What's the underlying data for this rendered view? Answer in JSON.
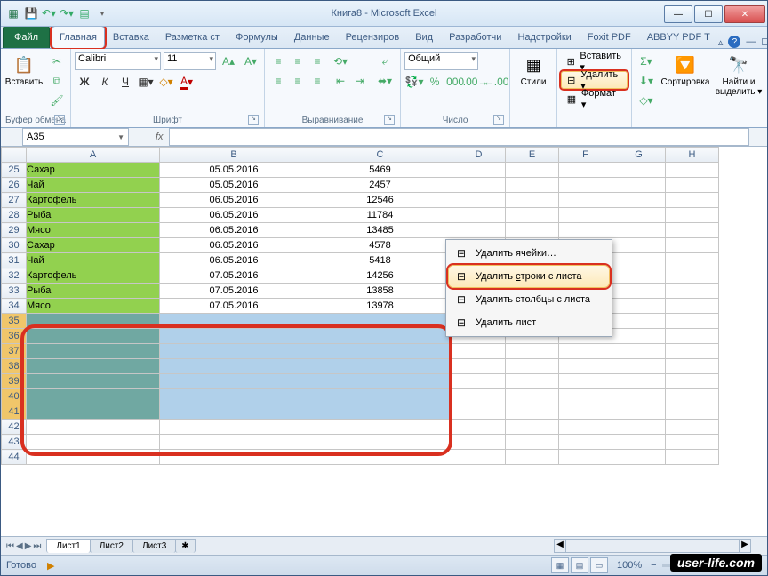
{
  "title": "Книга8 - Microsoft Excel",
  "tabs": {
    "file": "Файл",
    "home": "Главная",
    "t2": "Вставка",
    "t3": "Разметка ст",
    "t4": "Формулы",
    "t5": "Данные",
    "t6": "Рецензиров",
    "t7": "Вид",
    "t8": "Разработчи",
    "t9": "Надстройки",
    "t10": "Foxit PDF",
    "t11": "ABBYY PDF T"
  },
  "ribbon": {
    "clipboard": {
      "paste": "Вставить",
      "label": "Буфер обмена"
    },
    "font": {
      "name": "Calibri",
      "size": "11",
      "label": "Шрифт"
    },
    "align": {
      "label": "Выравнивание"
    },
    "number": {
      "format": "Общий",
      "label": "Число"
    },
    "styles": {
      "label": "Стили"
    },
    "cells": {
      "insert": "Вставить ▾",
      "delete": "Удалить ▾",
      "format": "Формат ▾"
    },
    "editing": {
      "sort": "Сортировка",
      "find": "Найти и выделить ▾"
    }
  },
  "menu": {
    "i1": "Удалить ячейки…",
    "i2": "Удалить строки с листа",
    "i3": "Удалить столбцы с листа",
    "i4": "Удалить лист"
  },
  "namebox": "A35",
  "fx": "fx",
  "cols": [
    "A",
    "B",
    "C",
    "D",
    "E",
    "F",
    "G",
    "H"
  ],
  "rows": [
    {
      "n": 25,
      "a": "Сахар",
      "b": "05.05.2016",
      "c": "5469"
    },
    {
      "n": 26,
      "a": "Чай",
      "b": "05.05.2016",
      "c": "2457"
    },
    {
      "n": 27,
      "a": "Картофель",
      "b": "06.05.2016",
      "c": "12546"
    },
    {
      "n": 28,
      "a": "Рыба",
      "b": "06.05.2016",
      "c": "11784"
    },
    {
      "n": 29,
      "a": "Мясо",
      "b": "06.05.2016",
      "c": "13485"
    },
    {
      "n": 30,
      "a": "Сахар",
      "b": "06.05.2016",
      "c": "4578"
    },
    {
      "n": 31,
      "a": "Чай",
      "b": "06.05.2016",
      "c": "5418"
    },
    {
      "n": 32,
      "a": "Картофель",
      "b": "07.05.2016",
      "c": "14256"
    },
    {
      "n": 33,
      "a": "Рыба",
      "b": "07.05.2016",
      "c": "13858"
    },
    {
      "n": 34,
      "a": "Мясо",
      "b": "07.05.2016",
      "c": "13978"
    }
  ],
  "selrows": [
    35,
    36,
    37,
    38,
    39,
    40,
    41
  ],
  "emptyrows": [
    42,
    43,
    44
  ],
  "sheets": {
    "s1": "Лист1",
    "s2": "Лист2",
    "s3": "Лист3"
  },
  "status": {
    "ready": "Готово",
    "zoom": "100%"
  },
  "watermark": "user-life.com",
  "b": "Ж",
  "i": "К",
  "u": "Ч"
}
